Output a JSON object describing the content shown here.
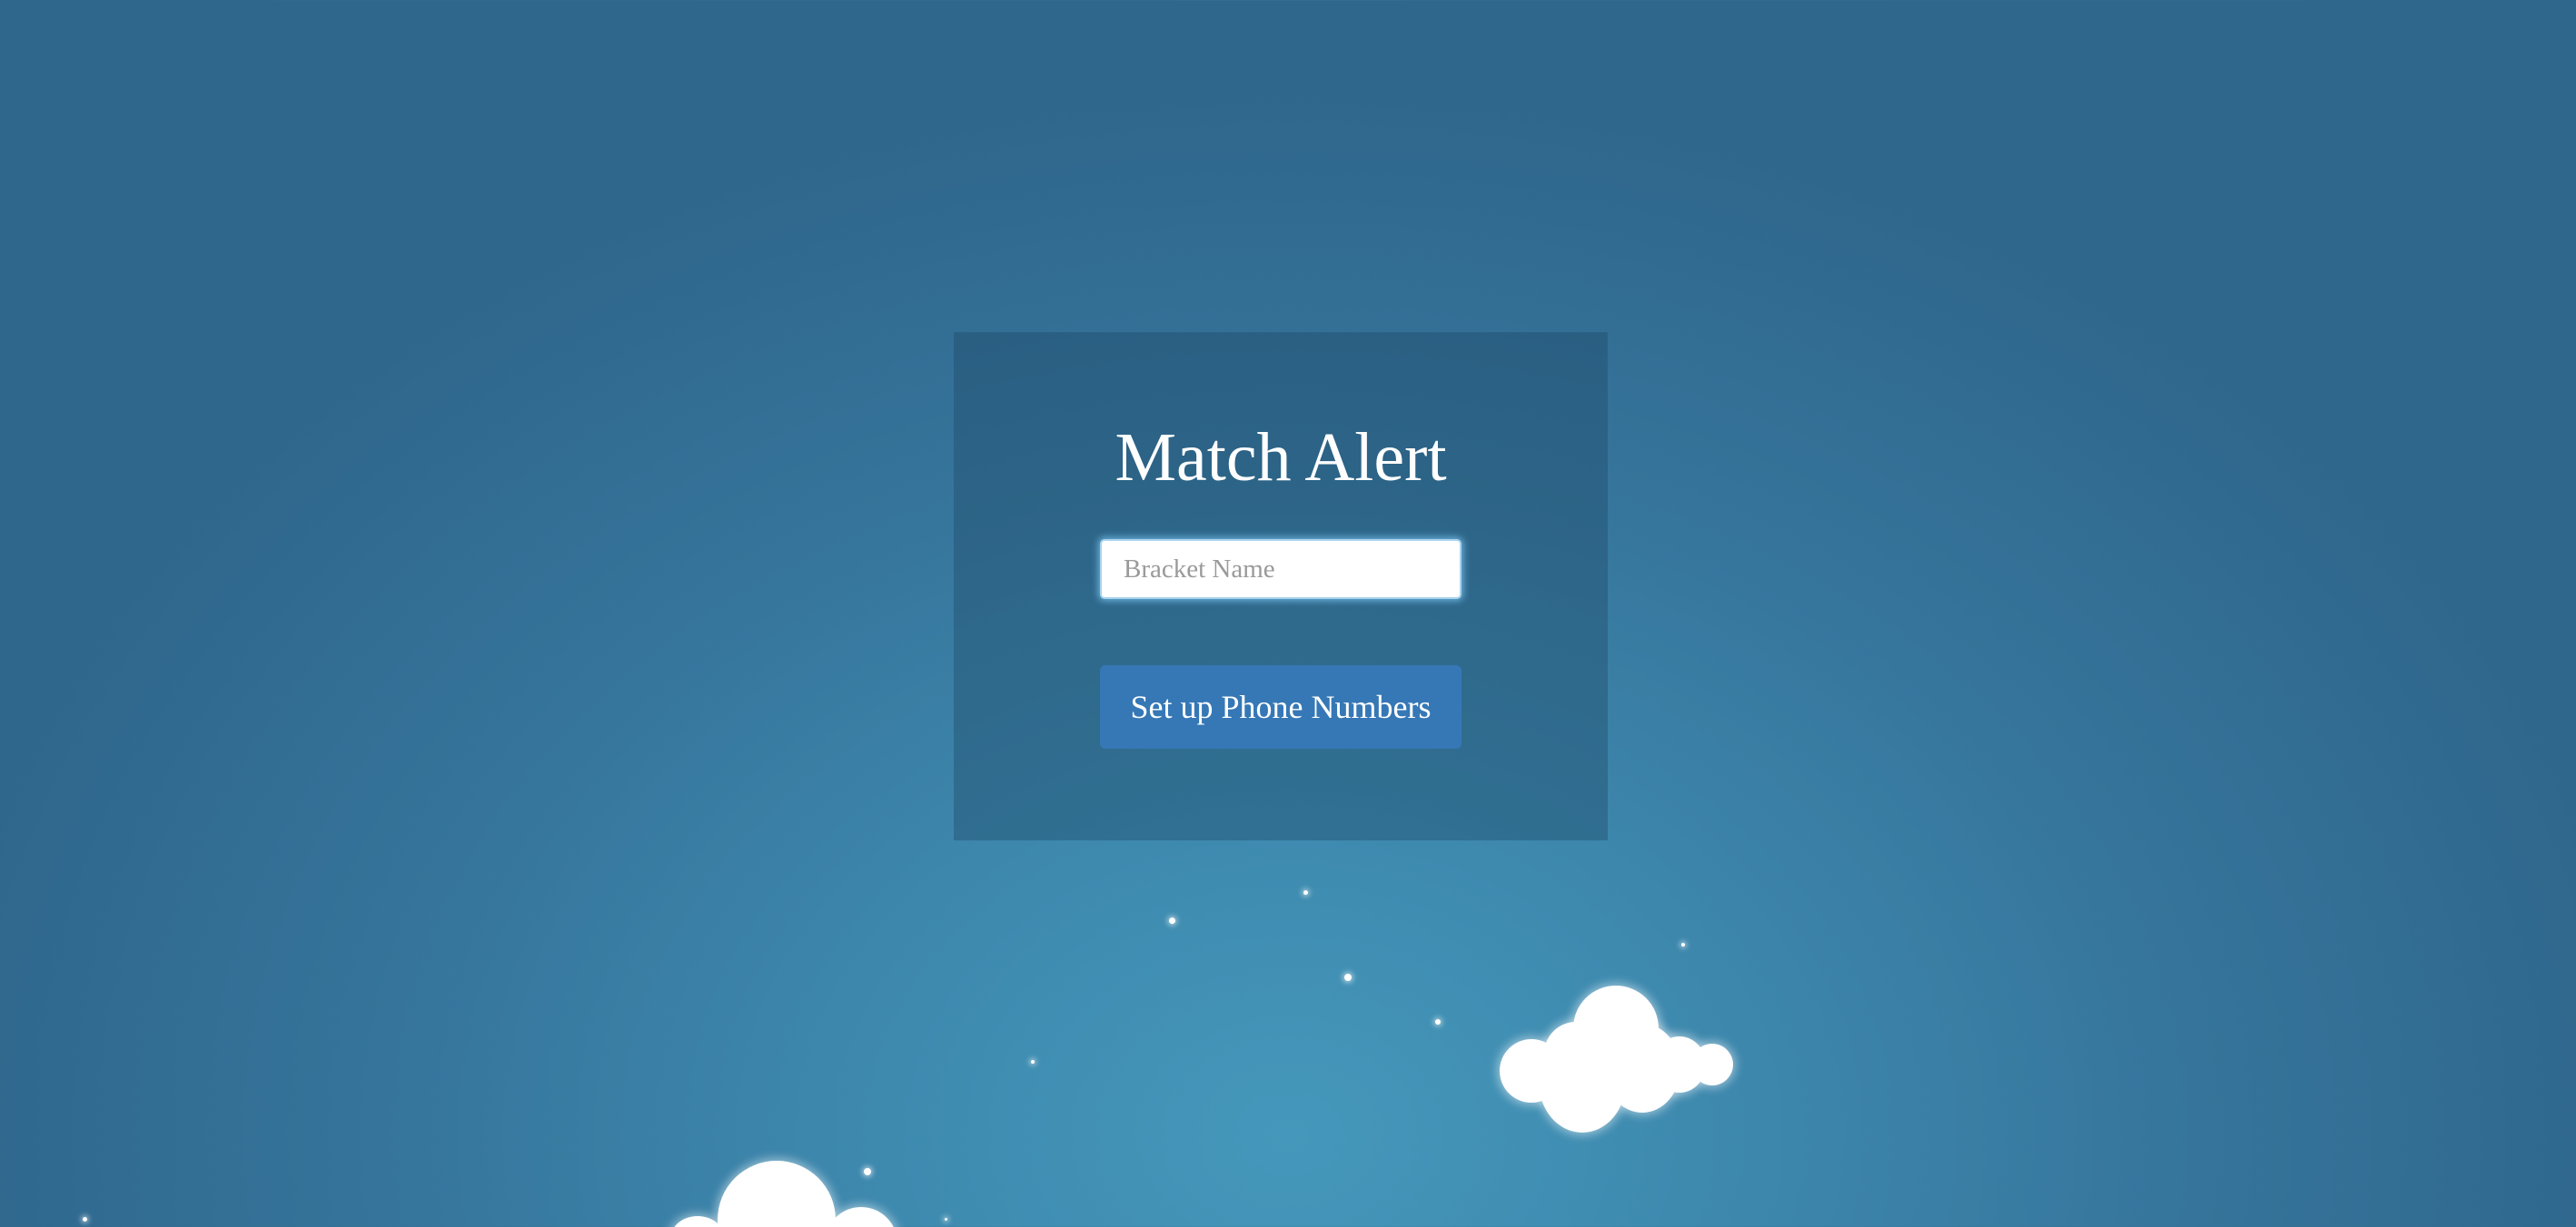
{
  "app": {
    "title": "Match Alert"
  },
  "form": {
    "bracket_name": {
      "value": "",
      "placeholder": "Bracket Name"
    },
    "setup_button_label": "Set up Phone Numbers"
  },
  "colors": {
    "background_center": "#4598bb",
    "background_edge": "#2f668c",
    "panel": "#24506e",
    "button": "#3678b6",
    "input_glow": "#78bee9"
  }
}
